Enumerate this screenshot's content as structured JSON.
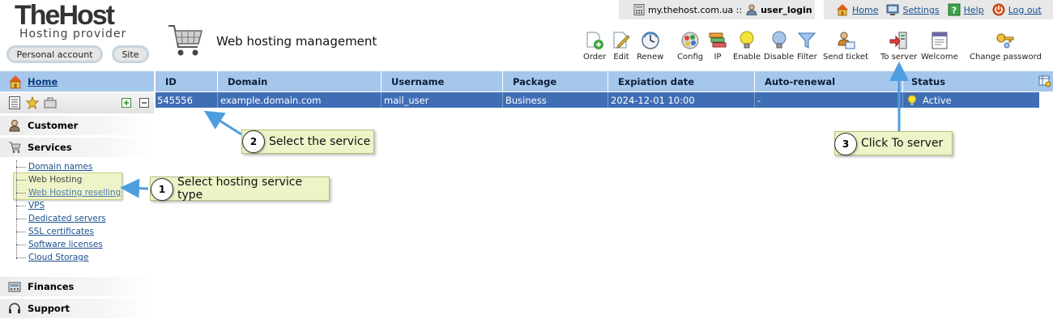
{
  "logo": {
    "title": "TheHost",
    "subtitle": "Hosting provider"
  },
  "header_buttons": {
    "personal": "Personal account",
    "site": "Site"
  },
  "page_title": "Web hosting management",
  "topbar": {
    "domain": "my.thehost.com.ua ::",
    "user": "user_login",
    "home": "Home",
    "settings": "Settings",
    "help": "Help",
    "logout": "Log out"
  },
  "toolbar": [
    {
      "label": "Order",
      "icon": "order-icon"
    },
    {
      "label": "Edit",
      "icon": "edit-icon"
    },
    {
      "label": "Renew",
      "icon": "renew-icon"
    },
    {
      "label": "Config",
      "icon": "config-icon"
    },
    {
      "label": "IP",
      "icon": "ip-icon"
    },
    {
      "label": "Enable",
      "icon": "enable-icon"
    },
    {
      "label": "Disable",
      "icon": "disable-icon"
    },
    {
      "label": "Filter",
      "icon": "filter-icon"
    },
    {
      "label": "Send ticket",
      "icon": "send-ticket-icon"
    },
    {
      "label": "To server",
      "icon": "to-server-icon"
    },
    {
      "label": "Welcome",
      "icon": "welcome-icon"
    },
    {
      "label": "Change password",
      "icon": "change-password-icon"
    }
  ],
  "sidebar": {
    "home": "Home",
    "customer": "Customer",
    "services": "Services",
    "service_items": [
      "Domain names",
      "Web Hosting",
      "Web Hosting reselling",
      "VPS",
      "Dedicated servers",
      "SSL certificates",
      "Software licenses",
      "Cloud Storage"
    ],
    "finances": "Finances",
    "support": "Support"
  },
  "table": {
    "columns": [
      "ID",
      "Domain",
      "Username",
      "Package",
      "Expiation date",
      "Auto-renewal",
      "Status"
    ],
    "rows": [
      {
        "id": "545556",
        "domain": "example.domain.com",
        "username": "mail_user",
        "package": "Business",
        "expiration": "2024-12-01 10:00",
        "autorenew": "-",
        "status": "Active"
      }
    ]
  },
  "callouts": [
    {
      "num": "1",
      "text": "Select hosting service type"
    },
    {
      "num": "2",
      "text": "Select the service"
    },
    {
      "num": "3",
      "text": "Click To server"
    }
  ],
  "colors": {
    "header_blue": "#a6c7ec",
    "selected_row": "#3f6eb5",
    "callout_bg": "#eef3c8",
    "arrow": "#4d9de0"
  }
}
